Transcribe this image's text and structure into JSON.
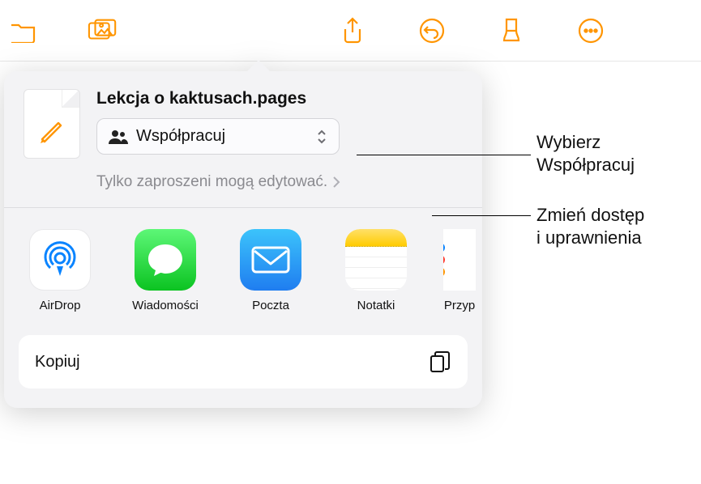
{
  "toolbar": {
    "icons": [
      "documents-icon",
      "photos-icon",
      "share-icon",
      "undo-icon",
      "format-brush-icon",
      "more-icon"
    ]
  },
  "sheet": {
    "doc_title": "Lekcja o kaktusach.pages",
    "collab_label": "Współpracuj",
    "access_text": "Tylko zaproszeni mogą edytować.",
    "apps": [
      {
        "id": "airdrop",
        "label": "AirDrop"
      },
      {
        "id": "messages",
        "label": "Wiadomości"
      },
      {
        "id": "mail",
        "label": "Poczta"
      },
      {
        "id": "notes",
        "label": "Notatki"
      },
      {
        "id": "reminders",
        "label": "Przyp"
      }
    ],
    "copy_label": "Kopiuj"
  },
  "callouts": {
    "collab": "Wybierz Współpracuj",
    "access": "Zmień dostęp i uprawnienia"
  }
}
